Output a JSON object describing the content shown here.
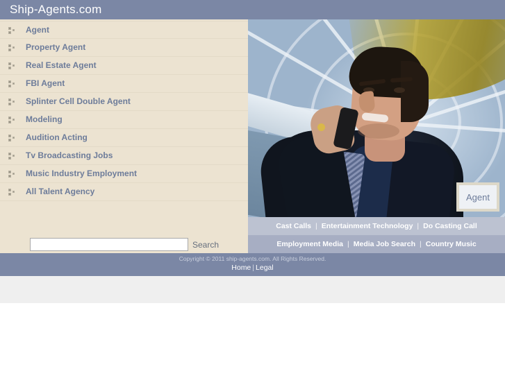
{
  "header": {
    "site_title": "Ship-Agents.com",
    "background_color": "#7b87a5"
  },
  "sidebar": {
    "background_color": "#ece3d1",
    "link_text_color": "#6d7c9a",
    "bullet_icon": "bullet-squares-icon",
    "items": [
      {
        "label": "Agent"
      },
      {
        "label": "Property Agent"
      },
      {
        "label": "Real Estate Agent"
      },
      {
        "label": "FBI Agent"
      },
      {
        "label": "Splinter Cell Double Agent"
      },
      {
        "label": "Modeling"
      },
      {
        "label": "Audition Acting"
      },
      {
        "label": "Tv Broadcasting Jobs"
      },
      {
        "label": "Music Industry Employment"
      },
      {
        "label": "All Talent Agency"
      }
    ]
  },
  "search": {
    "value": "",
    "placeholder": "",
    "button_label": "Search"
  },
  "hero": {
    "badge_label": "Agent",
    "alt": "Businessman in dark suit talking on a mobile phone in front of a glass dome atrium"
  },
  "bottom_nav": {
    "row1": [
      {
        "label": "Cast Calls"
      },
      {
        "label": "Entertainment Technology"
      },
      {
        "label": "Do Casting Call"
      }
    ],
    "row2": [
      {
        "label": "Employment Media"
      },
      {
        "label": "Media Job Search"
      },
      {
        "label": "Country Music"
      }
    ],
    "separator": "|",
    "row1_background_color": "#bcc2d1",
    "row2_background_color": "#a7aec3"
  },
  "footer": {
    "copyright": "Copyright © 2011 ship-agents.com. All Rights Reserved.",
    "links": [
      {
        "label": "Home"
      },
      {
        "label": "Legal"
      }
    ],
    "separator": "|",
    "background_color": "#7b87a5"
  }
}
